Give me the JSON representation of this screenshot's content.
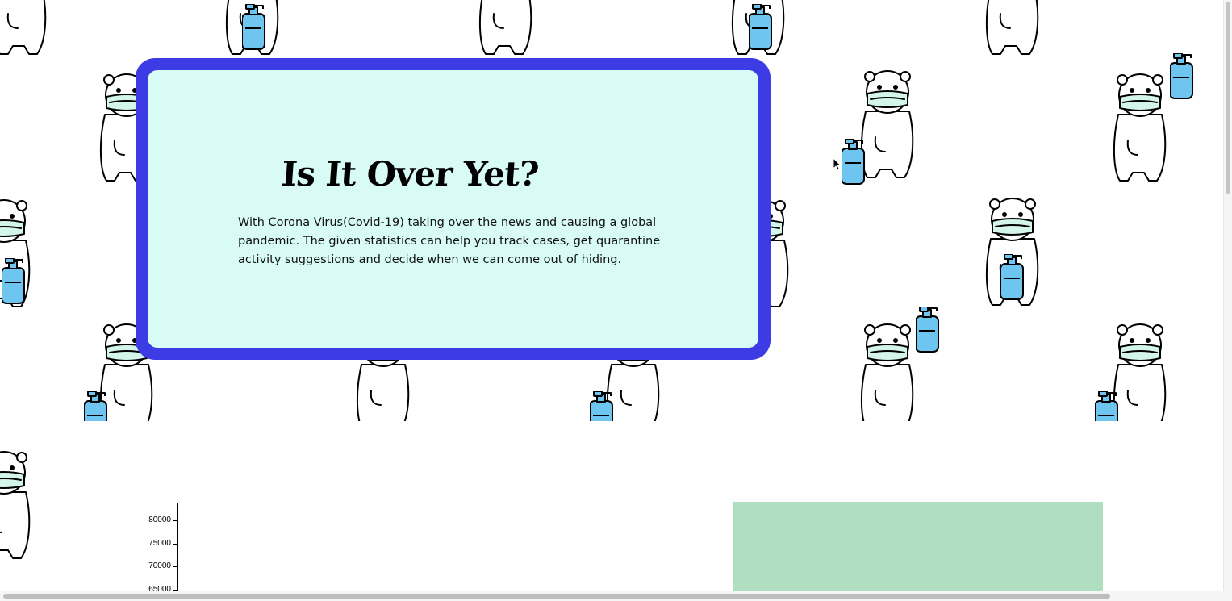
{
  "hero": {
    "title": "Is It Over Yet?",
    "description": "With Corona Virus(Covid-19) taking over the news and causing a global pandemic. The given statistics can help you track cases, get quarantine activity suggestions and decide when we can come out of hiding."
  },
  "background": {
    "pattern_icon": "masked-bear-with-sanitizer-icon"
  },
  "chart_data": {
    "type": "bar",
    "y_ticks": [
      "80000",
      "75000",
      "70000",
      "65000"
    ]
  },
  "colors": {
    "card_border": "#3c3be4",
    "card_fill": "#d8fbf6",
    "panel_green": "#b0dec1",
    "mask": "#d4f5ea",
    "bottle": "#6ec6f0"
  }
}
